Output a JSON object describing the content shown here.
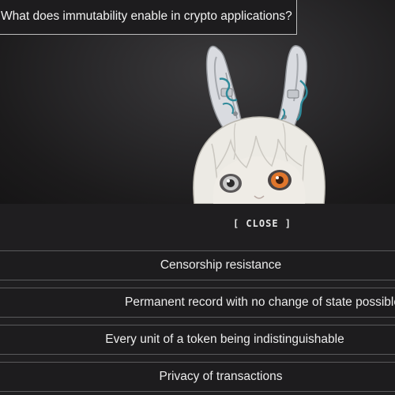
{
  "quiz": {
    "question": "What does immutability enable in crypto applications?",
    "close_label": "[ CLOSE ]",
    "options": [
      "Censorship resistance",
      "Permanent record with no change of state possible",
      "Every unit of a token being indistinguishable",
      "Privacy of transactions"
    ]
  },
  "colors": {
    "background": "#1f1e1f",
    "stage_light": "#3a393b",
    "border": "#5a5a5c",
    "question_border": "#bdbdbd",
    "text": "#ececec",
    "eye_left": "#c9c9c9",
    "eye_right": "#e0762c",
    "ear_cable": "#2f8a9a"
  },
  "icons": {
    "character": "bunny-eared-girl-avatar"
  }
}
